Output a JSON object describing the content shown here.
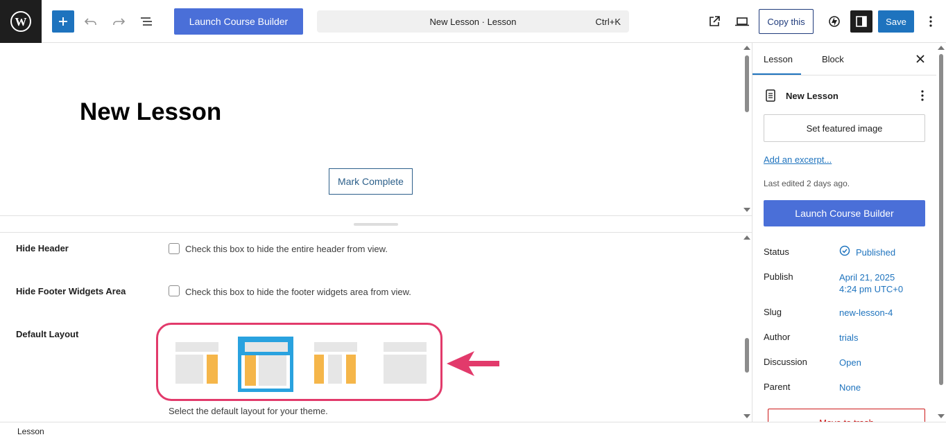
{
  "toolbar": {
    "wordpress_logo": "W",
    "inserter_icon": "plus-icon",
    "undo_icon": "undo-icon",
    "redo_icon": "redo-icon",
    "document_overview_icon": "list-view-icon",
    "launch_course_builder": "Launch Course Builder",
    "command_title": "New Lesson · Lesson",
    "command_shortcut": "Ctrl+K",
    "external_link_icon": "external-link-icon",
    "preview_icon": "laptop-icon",
    "copy_this": "Copy this",
    "jetpack_icon": "jetpack-icon",
    "settings_icon": "sidebar-toggle-icon",
    "save": "Save",
    "more_icon": "vertical-ellipsis-icon"
  },
  "canvas": {
    "post_title": "New Lesson",
    "mark_complete": "Mark Complete"
  },
  "meta": {
    "hide_header_label": "Hide Header",
    "hide_header_text": "Check this box to hide the entire header from view.",
    "hide_footer_label": "Hide Footer Widgets Area",
    "hide_footer_text": "Check this box to hide the footer widgets area from view.",
    "default_layout_label": "Default Layout",
    "layout_options": [
      {
        "name": "right-sidebar",
        "selected": false
      },
      {
        "name": "left-sidebar",
        "selected": true
      },
      {
        "name": "both-sidebars",
        "selected": false
      },
      {
        "name": "no-sidebar",
        "selected": false
      }
    ],
    "layout_hint": "Select the default layout for your theme."
  },
  "sidebar": {
    "tab_lesson": "Lesson",
    "tab_block": "Block",
    "doc_title": "New Lesson",
    "featured_image": "Set featured image",
    "excerpt_link": "Add an excerpt...",
    "last_edited": "Last edited 2 days ago.",
    "launch_course_builder": "Launch Course Builder",
    "rows": [
      {
        "label": "Status",
        "value": "Published"
      },
      {
        "label": "Publish",
        "value": "April 21, 2025",
        "value2": "4:24 pm UTC+0"
      },
      {
        "label": "Slug",
        "value": "new-lesson-4"
      },
      {
        "label": "Author",
        "value": "trials"
      },
      {
        "label": "Discussion",
        "value": "Open"
      },
      {
        "label": "Parent",
        "value": "None"
      }
    ],
    "move_to_trash": "Move to trash"
  },
  "footer": {
    "breadcrumb": "Lesson"
  },
  "colors": {
    "accent": "#1e73be",
    "course_builder": "#4a6fd8",
    "highlight": "#e23a6b",
    "layout_selected": "#29a2df",
    "layout_sidebar": "#f5b64a"
  }
}
